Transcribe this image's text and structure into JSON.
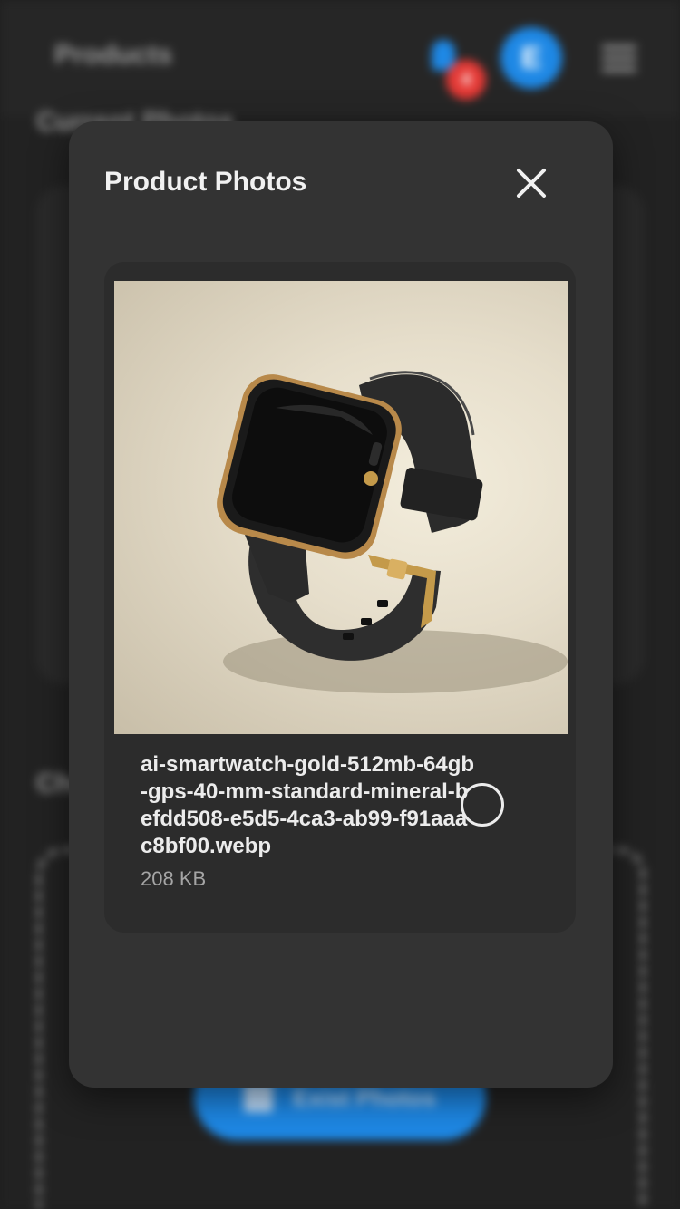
{
  "background": {
    "header_title": "Products",
    "notification_count": "4",
    "avatar_initial": "E",
    "section_title_1": "Current Photos",
    "section_title_2": "Choose Photos",
    "exist_photos_label": "Exist Photos"
  },
  "modal": {
    "title": "Product Photos",
    "close_icon": "close-icon",
    "photos": [
      {
        "file_name": "ai-smartwatch-gold-512mb-64gb-gps-40-mm-standard-mineral-befdd508-e5d5-4ca3-ab99-f91aaac8bf00.webp",
        "file_size": "208 KB",
        "selected": false
      }
    ]
  },
  "colors": {
    "accent": "#1e88e5",
    "badge": "#e53935",
    "modal_bg": "#333333",
    "card_bg": "#2c2c2c"
  }
}
